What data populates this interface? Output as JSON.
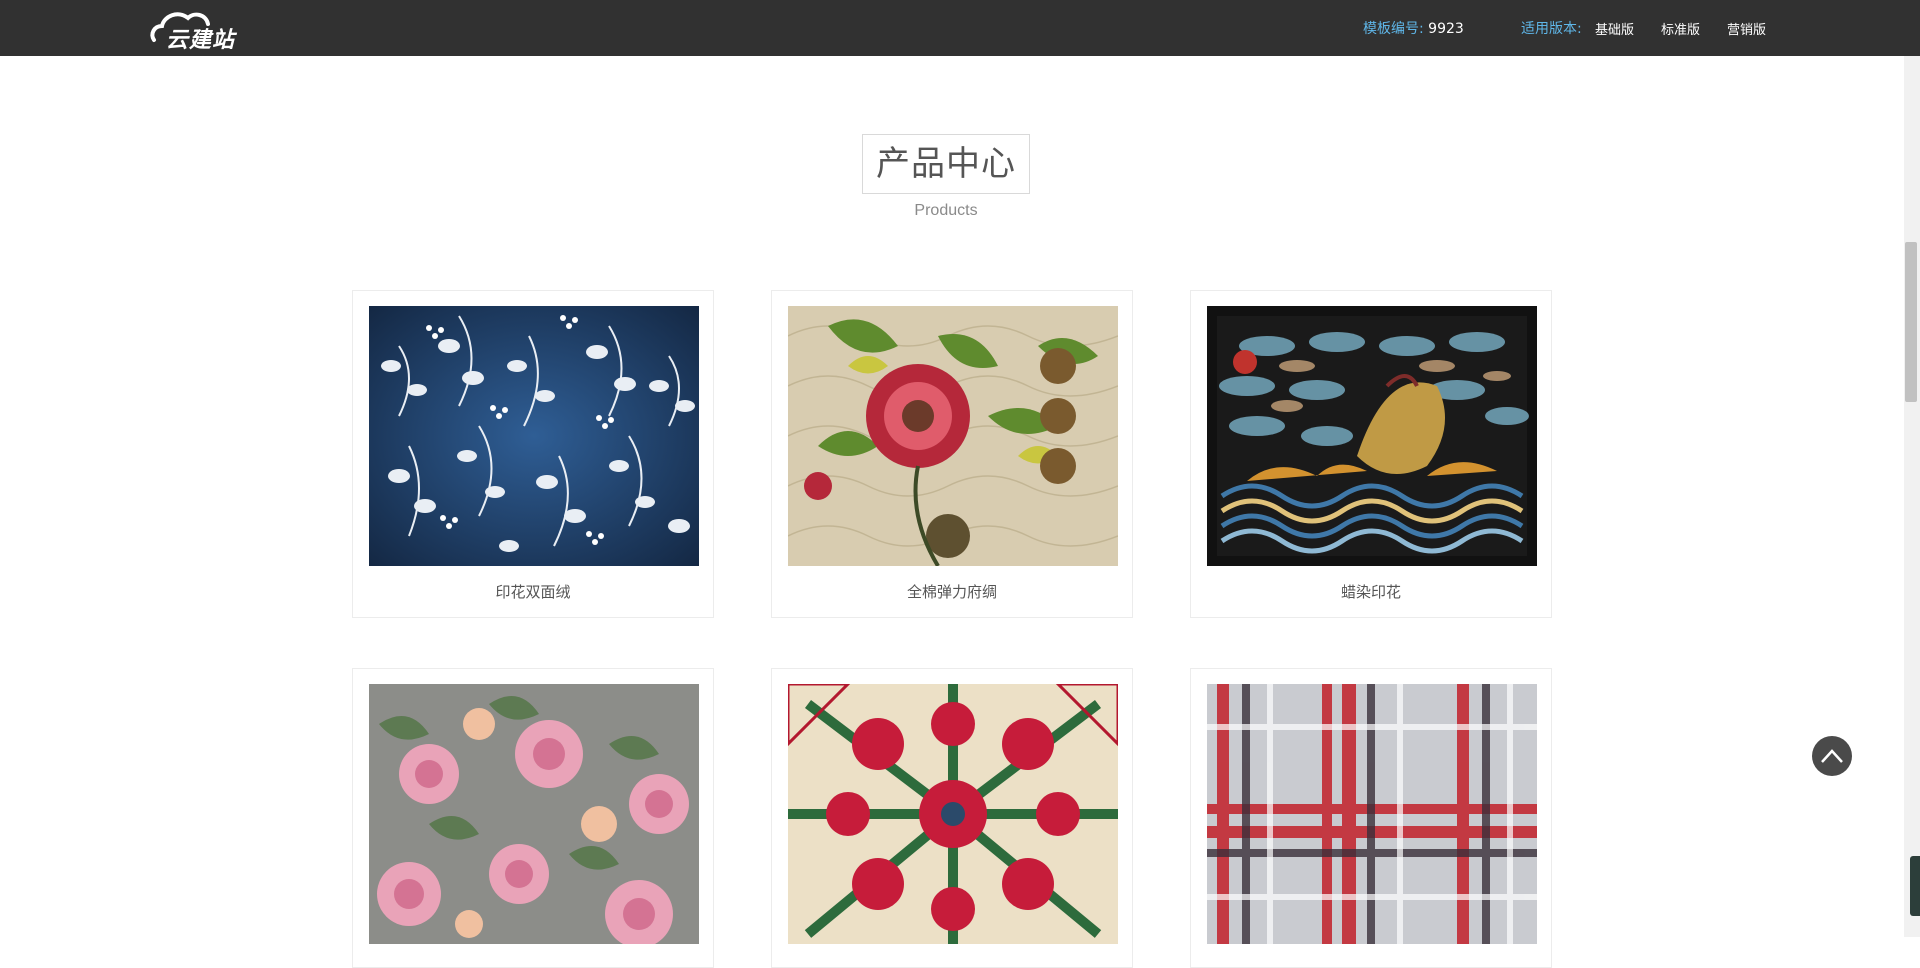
{
  "header": {
    "logo_text": "云建站",
    "template_label": "模板编号:",
    "template_number": "9923",
    "versions_label": "适用版本:",
    "versions": [
      "基础版",
      "标准版",
      "营销版"
    ]
  },
  "section": {
    "title": "产品中心",
    "subtitle": "Products"
  },
  "products": [
    {
      "name": "印花双面绒"
    },
    {
      "name": "全棉弹力府绸"
    },
    {
      "name": "蜡染印花"
    },
    {
      "name": ""
    },
    {
      "name": ""
    },
    {
      "name": ""
    }
  ],
  "colors": {
    "topbar": "#313131",
    "accent": "#5fb6e8"
  },
  "icons": {
    "back_to_top": "chevron-up-icon"
  }
}
